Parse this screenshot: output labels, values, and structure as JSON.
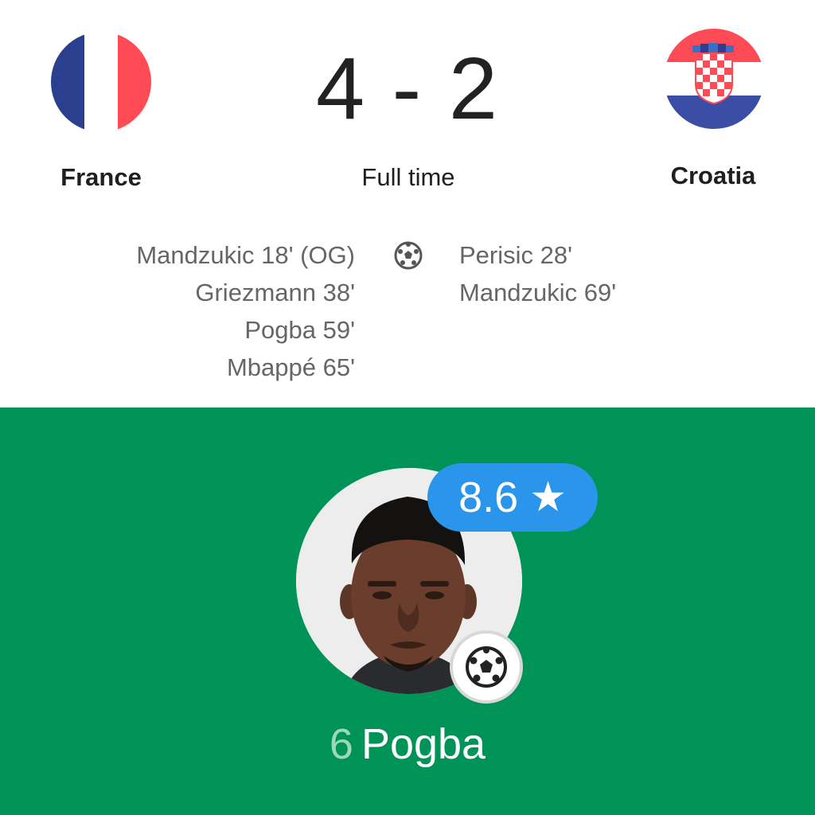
{
  "match": {
    "home": {
      "name": "France",
      "flag_icon": "france-flag-icon",
      "flag_colors": [
        "#2b3f8f",
        "#ffffff",
        "#ff4b55"
      ],
      "scorers": [
        "Mandzukic 18' (OG)",
        "Griezmann 38'",
        "Pogba 59'",
        "Mbappé 65'"
      ]
    },
    "away": {
      "name": "Croatia",
      "flag_icon": "croatia-flag-icon",
      "flag_colors": [
        "#ff4b55",
        "#ffffff",
        "#3b4ea6"
      ],
      "scorers": [
        "Perisic 28'",
        "Mandzukic 69'"
      ]
    },
    "score": "4 - 2",
    "status": "Full time",
    "goal_icon": "soccer-ball-icon"
  },
  "player_of_match": {
    "number": "6",
    "name": "Pogba",
    "rating": "8.6",
    "rating_icon": "star-icon",
    "badge_icon": "soccer-ball-icon",
    "photo": "player-photo",
    "background_color": "#009357",
    "rating_color": "#2a95ea"
  }
}
